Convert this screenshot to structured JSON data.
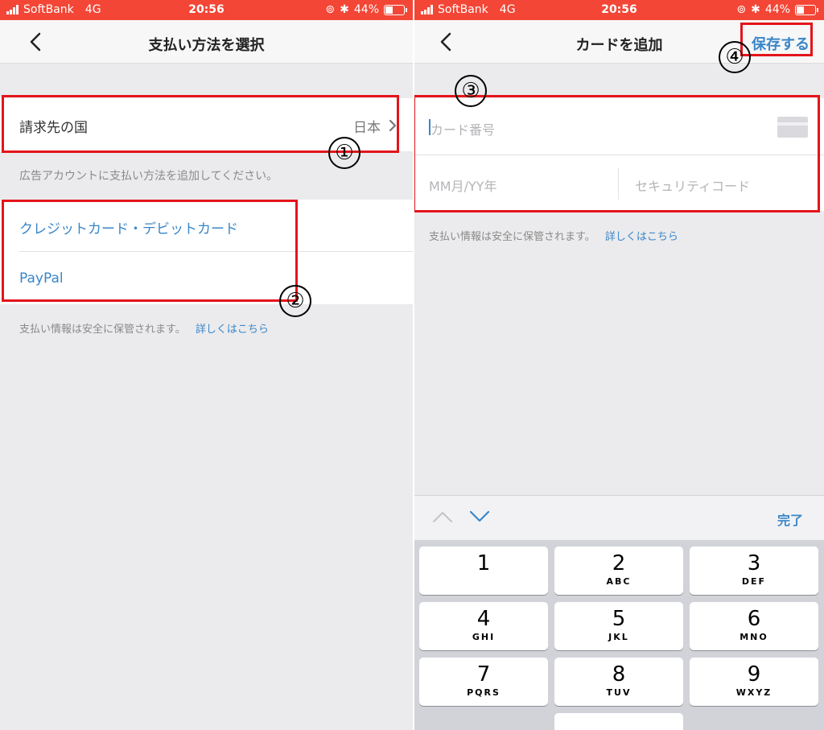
{
  "status_bar": {
    "carrier": "SoftBank",
    "network": "4G",
    "time": "20:56",
    "battery": "44%",
    "battery_level": 0.44
  },
  "left_screen": {
    "title": "支払い方法を選択",
    "billing_country_label": "請求先の国",
    "billing_country_value": "日本",
    "instruction": "広告アカウントに支払い方法を追加してください。",
    "payment_methods": [
      "クレジットカード・デビットカード",
      "PayPal"
    ],
    "secure_note": "支払い情報は安全に保管されます。",
    "learn_more": "詳しくはこちら"
  },
  "right_screen": {
    "title": "カードを追加",
    "save_label": "保存する",
    "card_number_placeholder": "カード番号",
    "expiry_placeholder": "MM月/YY年",
    "security_code_placeholder": "セキュリティコード",
    "secure_note": "支払い情報は安全に保管されます。",
    "learn_more": "詳しくはこちら",
    "done_label": "完了"
  },
  "keyboard": {
    "keys": [
      {
        "digit": "1",
        "letters": ""
      },
      {
        "digit": "2",
        "letters": "ABC"
      },
      {
        "digit": "3",
        "letters": "DEF"
      },
      {
        "digit": "4",
        "letters": "GHI"
      },
      {
        "digit": "5",
        "letters": "JKL"
      },
      {
        "digit": "6",
        "letters": "MNO"
      },
      {
        "digit": "7",
        "letters": "PQRS"
      },
      {
        "digit": "8",
        "letters": "TUV"
      },
      {
        "digit": "9",
        "letters": "WXYZ"
      }
    ]
  },
  "annotations": [
    "①",
    "②",
    "③",
    "④"
  ],
  "colors": {
    "status_bar": "#f34636",
    "link": "#3a86c8",
    "highlight": "#e4141b"
  },
  "icons": [
    "signal-icon",
    "alarm-icon",
    "bluetooth-icon",
    "battery-icon",
    "back-chevron-icon",
    "chevron-right-icon",
    "card-icon",
    "chevron-up-icon",
    "chevron-down-icon"
  ]
}
